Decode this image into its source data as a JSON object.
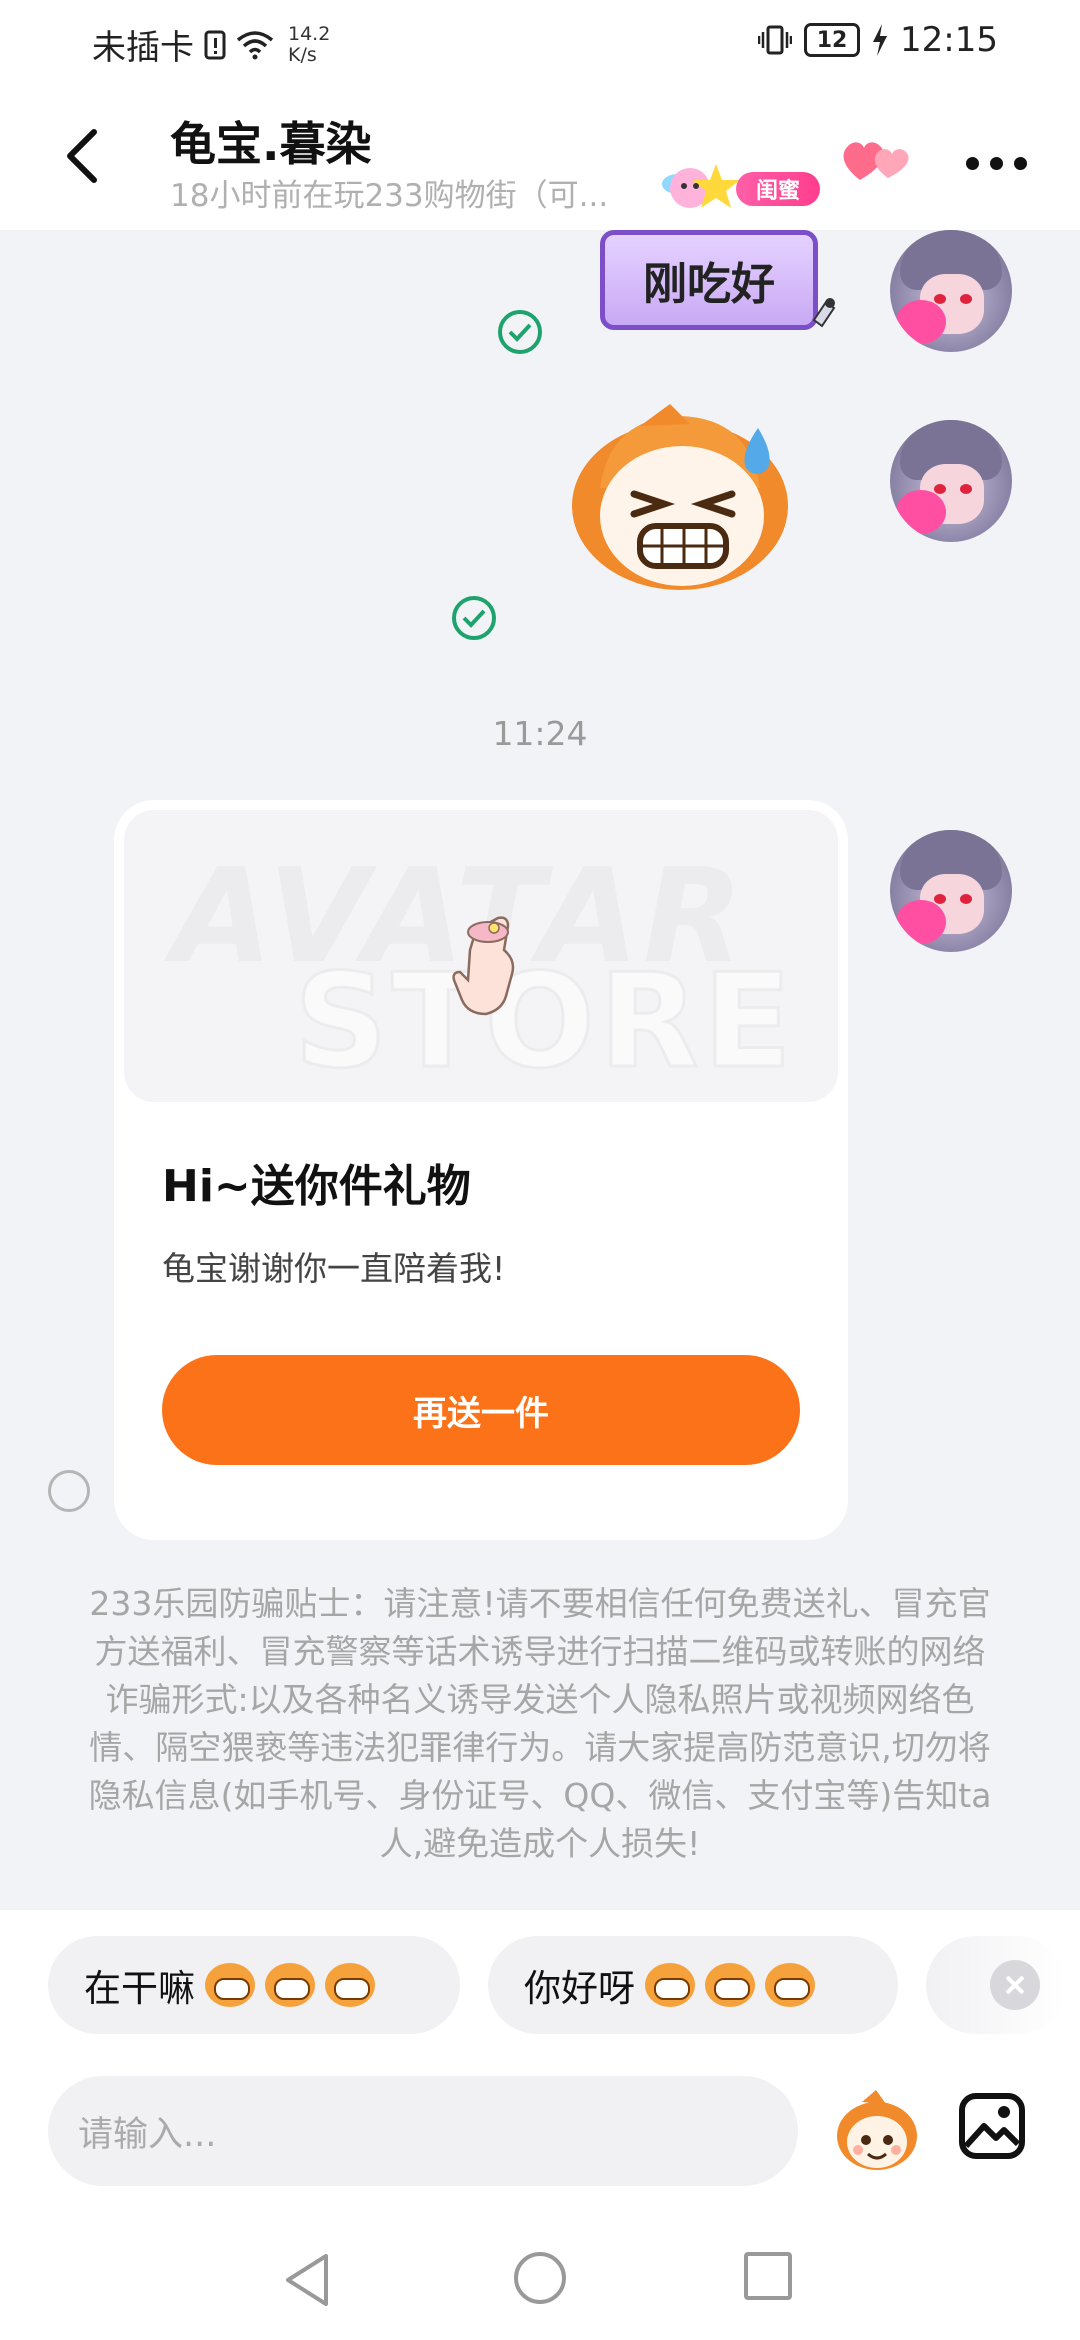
{
  "status_bar": {
    "sim": "未插卡",
    "net_speed_value": "14.2",
    "net_speed_unit": "K/s",
    "battery": "12",
    "time": "12:15"
  },
  "header": {
    "title": "龟宝.暮染",
    "subtitle": "18小时前在玩233购物街（可...",
    "relation_badge": "闺蜜"
  },
  "messages": {
    "sticker_text": "刚吃好",
    "time_label": "11:24"
  },
  "gift_card": {
    "watermark_line1": "AVATAR",
    "watermark_line2": "STORE",
    "title": "Hi~送你件礼物",
    "subtitle": "龟宝谢谢你一直陪着我!",
    "button_label": "再送一件"
  },
  "warning_text": "233乐园防骗贴士：请注意!请不要相信任何免费送礼、冒充官方送福利、冒充警察等话术诱导进行扫描二维码或转账的网络诈骗形式:以及各种名义诱导发送个人隐私照片或视频网络色情、隔空猥亵等违法犯罪律行为。请大家提高防范意识,切勿将隐私信息(如手机号、身份证号、QQ、微信、支付宝等)告知ta人,避免造成个人损失!",
  "quick_replies": [
    {
      "text": "在干嘛"
    },
    {
      "text": "你好呀"
    }
  ],
  "input": {
    "placeholder": "请输入..."
  },
  "colors": {
    "accent": "#fb7218",
    "check": "#1fa36c",
    "badge": "#ff3d8d"
  }
}
